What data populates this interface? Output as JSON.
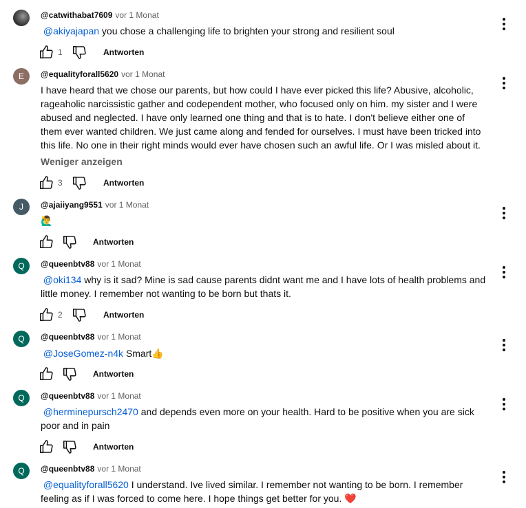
{
  "common": {
    "reply_label": "Antworten",
    "show_less_label": "Weniger anzeigen",
    "mention_color": "#065fd4"
  },
  "comments": [
    {
      "author": "@catwithabat7609",
      "time": "vor 1 Monat",
      "avatar_letter": "",
      "avatar_color": "#3a3a3a",
      "mention": "@akiyajapan",
      "text": " you chose a challenging life to brighten your strong and resilient soul",
      "likes": "1"
    },
    {
      "author": "@equalityforall5620",
      "time": "vor 1 Monat",
      "avatar_letter": "E",
      "avatar_color": "#8d6e63",
      "text": "I have heard that we chose our parents, but how could  I have ever picked this life? Abusive, alcoholic, rageaholic narcissistic gather and codependent mother, who focused only on him. my sister and I were abused and neglected. I have only learned one thing and that is to hate. I don't believe either one of them ever wanted children. We just came along and fended for ourselves. I must have been tricked into this life. No one in their right minds would ever have chosen such an awful life. Or I was misled about it.",
      "likes": "3"
    },
    {
      "author": "@ajaiiyang9551",
      "time": "vor 1 Monat",
      "avatar_letter": "J",
      "avatar_color": "#455a64",
      "text": "🙋‍♂️",
      "likes": ""
    },
    {
      "author": "@queenbtv88",
      "time": "vor 1 Monat",
      "avatar_letter": "Q",
      "avatar_color": "#00695c",
      "mention": "@oki134",
      "text": " why is it sad? Mine is sad cause parents didnt want me and I have lots of health problems and little money. I remember not wanting to be born but thats it.",
      "likes": "2"
    },
    {
      "author": "@queenbtv88",
      "time": "vor 1 Monat",
      "avatar_letter": "Q",
      "avatar_color": "#00695c",
      "mention": "@JoseGomez-n4k",
      "text": " Smart👍",
      "likes": ""
    },
    {
      "author": "@queenbtv88",
      "time": "vor 1 Monat",
      "avatar_letter": "Q",
      "avatar_color": "#00695c",
      "mention": "@herminepursch2470",
      "text": " and depends even more on your health. Hard to be positive when you are sick poor and in pain",
      "likes": ""
    },
    {
      "author": "@queenbtv88",
      "time": "vor 1 Monat",
      "avatar_letter": "Q",
      "avatar_color": "#00695c",
      "mention": "@equalityforall5620",
      "text": " I understand. Ive lived similar. I remember not wanting to be born. I remember feeling as if I was forced to come here. I hope things get better for you. ❤️",
      "likes": ""
    }
  ]
}
